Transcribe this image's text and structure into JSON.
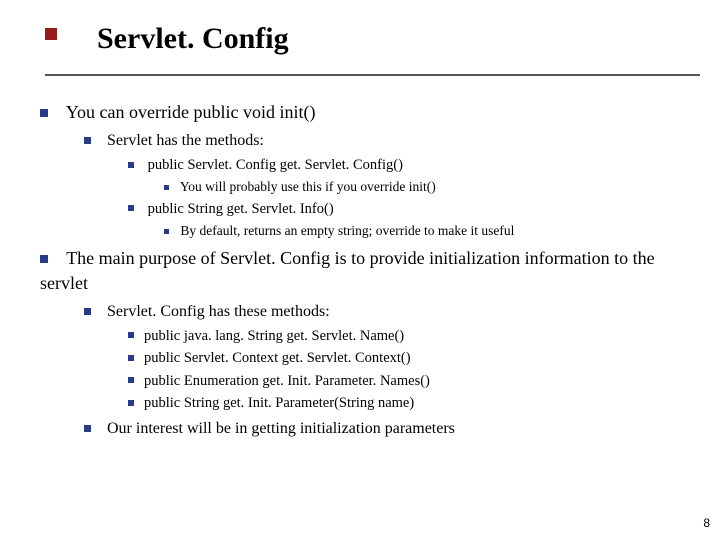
{
  "title": "Servlet. Config",
  "page_number": "8",
  "l1": [
    {
      "prefix": "You can override ",
      "code": "public void init()",
      "l2": [
        {
          "code": "Servlet",
          "suffix": " has the methods:",
          "l3": [
            {
              "code": "public Servlet. Config get. Servlet. Config()",
              "l4": [
                {
                  "prefix": "You will probably use this if you override ",
                  "code": "init()"
                }
              ]
            },
            {
              "code": "public String get. Servlet. Info()",
              "l4": [
                {
                  "text": "By default, returns an empty string; override to make it useful"
                }
              ]
            }
          ]
        }
      ]
    },
    {
      "prefix": "The main purpose of ",
      "code": "Servlet. Config",
      "suffix": " is to provide initialization information to the servlet",
      "l2": [
        {
          "code": "Servlet. Config",
          "suffix": " has these methods:",
          "l3": [
            {
              "code": "public java. lang. String get. Servlet. Name()"
            },
            {
              "code": "public Servlet. Context get. Servlet. Context()"
            },
            {
              "code": "public Enumeration get. Init. Parameter. Names()"
            },
            {
              "code": "public String get. Init. Parameter(String name)"
            }
          ]
        },
        {
          "text": "Our interest will be in getting initialization parameters"
        }
      ]
    }
  ]
}
